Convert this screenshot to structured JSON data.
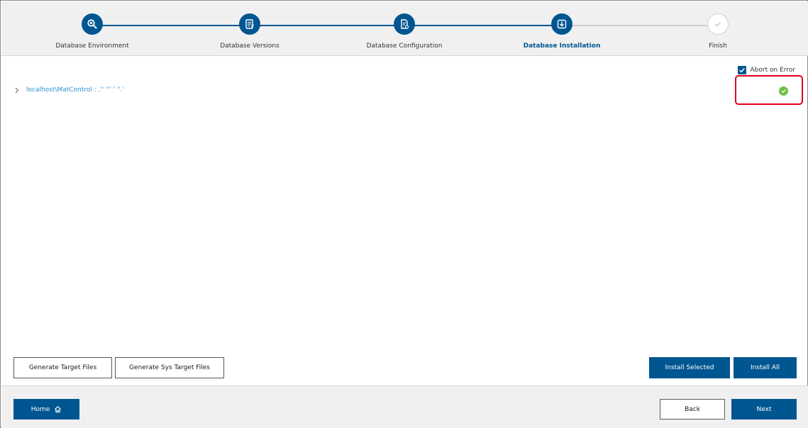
{
  "steps": [
    {
      "label": "Database Environment",
      "icon": "search-icon",
      "state": "done"
    },
    {
      "label": "Database Versions",
      "icon": "versions-document-icon",
      "state": "done"
    },
    {
      "label": "Database Configuration",
      "icon": "config-document-icon",
      "state": "done"
    },
    {
      "label": "Database Installation",
      "icon": "download-icon",
      "state": "active"
    },
    {
      "label": "Finish",
      "icon": "check-icon",
      "state": "pending"
    }
  ],
  "options": {
    "abort_on_error_label": "Abort on Error",
    "abort_on_error_checked": true
  },
  "tree": {
    "item_label": "localhost\\MatControl : .'' ''' ' ''.'"
  },
  "status": {
    "state": "success",
    "color": "#6fbf4a"
  },
  "actions": {
    "generate_target_files": "Generate Target Files",
    "generate_sys_target_files": "Generate Sys Target Files",
    "install_selected": "Install Selected",
    "install_all": "Install All"
  },
  "footer": {
    "home_label": "Home",
    "back_label": "Back",
    "next_label": "Next"
  },
  "colors": {
    "primary": "#005691",
    "link": "#2d8fd5",
    "highlight": "#e2001a",
    "success": "#6fbf4a"
  }
}
